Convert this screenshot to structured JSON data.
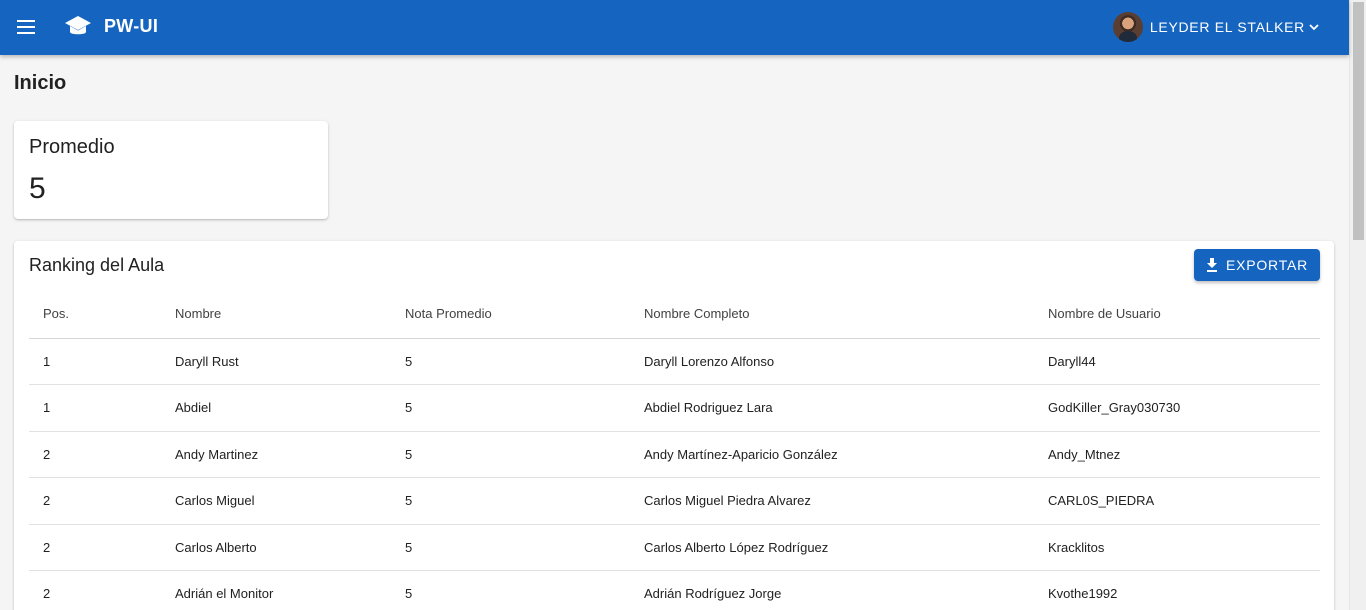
{
  "header": {
    "app_title": "PW-UI",
    "user_name": "LEYDER EL STALKER",
    "accent_color": "#1565c0"
  },
  "page": {
    "title": "Inicio"
  },
  "average_card": {
    "label": "Promedio",
    "value": "5"
  },
  "ranking": {
    "title": "Ranking del Aula",
    "export_label": "EXPORTAR",
    "columns": [
      "Pos.",
      "Nombre",
      "Nota Promedio",
      "Nombre Completo",
      "Nombre de Usuario"
    ],
    "rows": [
      [
        "1",
        "Daryll Rust",
        "5",
        "Daryll Lorenzo Alfonso",
        "Daryll44"
      ],
      [
        "1",
        "Abdiel",
        "5",
        "Abdiel Rodriguez Lara",
        "GodKiller_Gray030730"
      ],
      [
        "2",
        "Andy Martinez",
        "5",
        "Andy Martínez-Aparicio González",
        "Andy_Mtnez"
      ],
      [
        "2",
        "Carlos Miguel",
        "5",
        "Carlos Miguel Piedra Alvarez",
        "CARL0S_PIEDRA"
      ],
      [
        "2",
        "Carlos Alberto",
        "5",
        "Carlos Alberto López Rodríguez",
        "Kracklitos"
      ],
      [
        "2",
        "Adrián el Monitor",
        "5",
        "Adrián Rodríguez Jorge",
        "Kvothe1992"
      ]
    ]
  }
}
